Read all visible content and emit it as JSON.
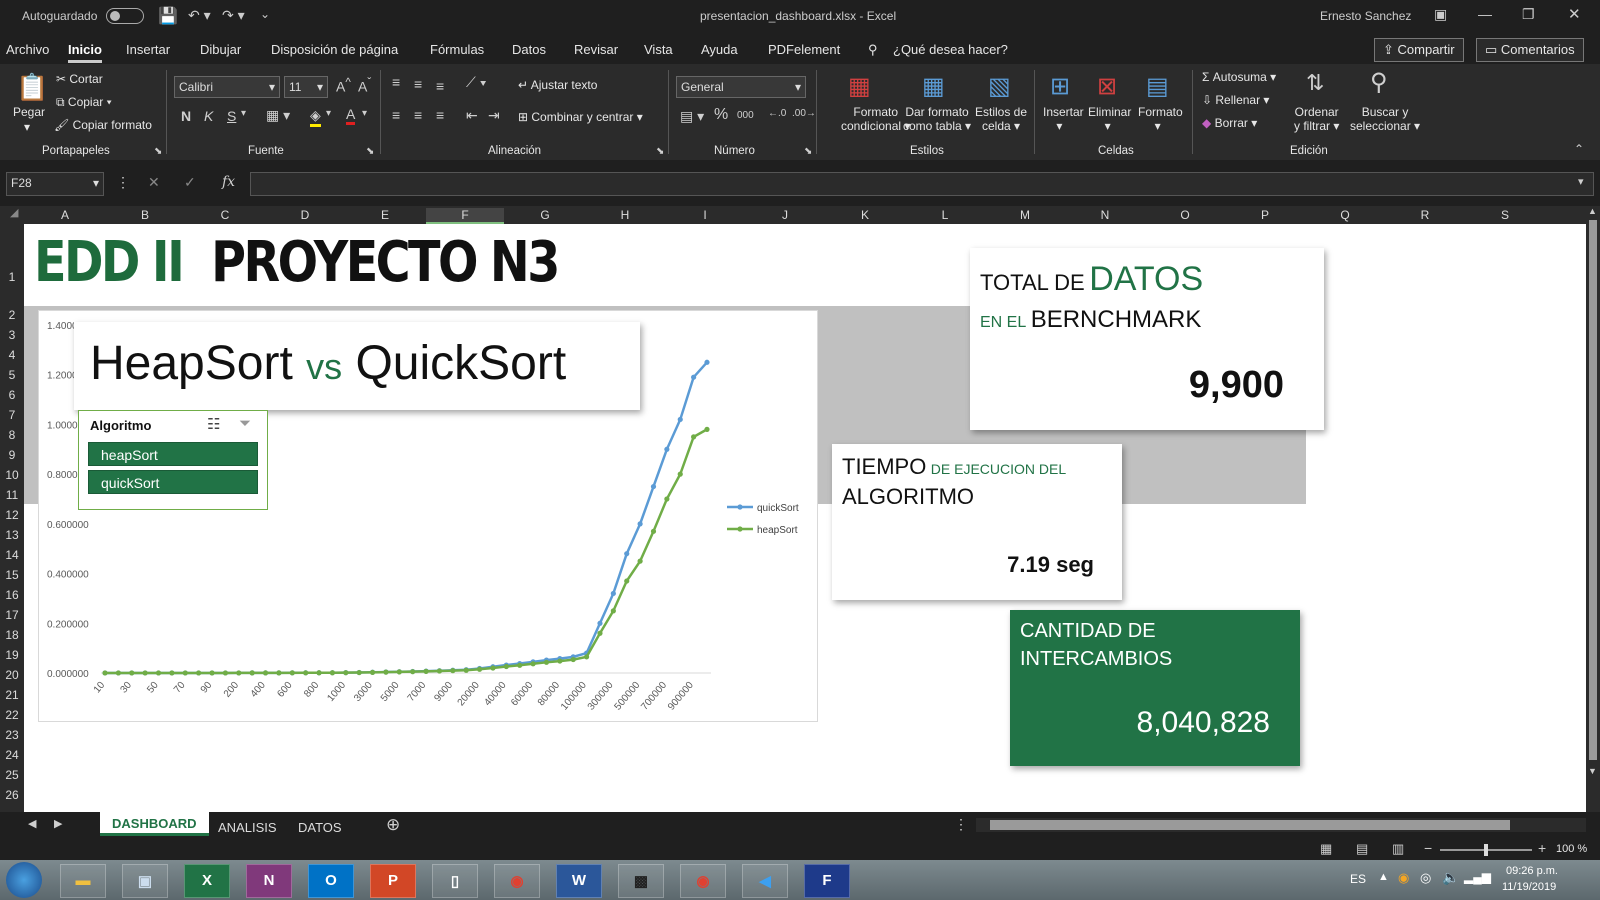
{
  "window": {
    "autosave_label": "Autoguardado",
    "title": "presentacion_dashboard.xlsx  -  Excel",
    "user": "Ernesto Sanchez"
  },
  "menu": {
    "items": [
      "Archivo",
      "Inicio",
      "Insertar",
      "Dibujar",
      "Disposición de página",
      "Fórmulas",
      "Datos",
      "Revisar",
      "Vista",
      "Ayuda",
      "PDFelement"
    ],
    "search_prompt": "¿Qué desea hacer?",
    "share": "Compartir",
    "comments": "Comentarios"
  },
  "ribbon": {
    "paste": "Pegar",
    "cut": "Cortar",
    "copy": "Copiar",
    "format_painter": "Copiar formato",
    "font_name": "Calibri",
    "font_size": "11",
    "bold": "N",
    "italic": "K",
    "underline": "S",
    "wrap_text": "Ajustar texto",
    "merge_center": "Combinar y centrar",
    "number_format": "General",
    "cond_format": [
      "Formato",
      "condicional"
    ],
    "format_table": [
      "Dar formato",
      "como tabla"
    ],
    "cell_styles": [
      "Estilos de",
      "celda"
    ],
    "insert": "Insertar",
    "delete": "Eliminar",
    "format": "Formato",
    "autosum": "Autosuma",
    "fill": "Rellenar",
    "clear": "Borrar",
    "sort_filter": [
      "Ordenar",
      "y filtrar"
    ],
    "find_select": [
      "Buscar y",
      "seleccionar"
    ],
    "groups": [
      "Portapapeles",
      "Fuente",
      "Alineación",
      "Número",
      "Estilos",
      "Celdas",
      "Edición"
    ]
  },
  "formula_bar": {
    "name_box": "F28",
    "fx": "fx"
  },
  "grid": {
    "columns": [
      "A",
      "B",
      "C",
      "D",
      "E",
      "F",
      "G",
      "H",
      "I",
      "J",
      "K",
      "L",
      "M",
      "N",
      "O",
      "P",
      "Q",
      "R",
      "S"
    ],
    "selected_column": "F",
    "rows": [
      "1",
      "2",
      "3",
      "4",
      "5",
      "6",
      "7",
      "8",
      "9",
      "10",
      "11",
      "12",
      "13",
      "14",
      "15",
      "16",
      "17",
      "18",
      "19",
      "20",
      "21",
      "22",
      "23",
      "24",
      "25",
      "26"
    ]
  },
  "dashboard": {
    "title_part1": "EDD II",
    "title_part2": "PROYECTO N3",
    "chart_title_a": "HeapSort",
    "chart_title_vs": "vs",
    "chart_title_b": "QuickSort",
    "slicer": {
      "title": "Algoritmo",
      "items": [
        "heapSort",
        "quickSort"
      ]
    },
    "total_card": {
      "l1_small": "TOTAL DE",
      "l1_big": "DATOS",
      "l2_small": "EN EL",
      "l2_big": "BERNCHMARK",
      "value": "9,900"
    },
    "time_card": {
      "l1_big": "TIEMPO",
      "l1_small": "DE EJECUCION DEL",
      "l2": "ALGORITMO",
      "value": "7.19 seg"
    },
    "swaps_card": {
      "l1": "CANTIDAD DE",
      "l2": "INTERCAMBIOS",
      "value": "8,040,828"
    }
  },
  "colors": {
    "excel_green": "#217346",
    "title_green": "#1e6b3c",
    "quick_blue": "#5b9bd5",
    "heap_green": "#70ad47"
  },
  "chart_data": {
    "type": "line",
    "title": "HeapSort vs QuickSort",
    "categories": [
      "10",
      "20",
      "30",
      "40",
      "50",
      "60",
      "70",
      "80",
      "90",
      "100",
      "200",
      "300",
      "400",
      "500",
      "600",
      "700",
      "800",
      "900",
      "1000",
      "2000",
      "3000",
      "4000",
      "5000",
      "6000",
      "7000",
      "8000",
      "9000",
      "10000",
      "20000",
      "30000",
      "40000",
      "50000",
      "60000",
      "70000",
      "80000",
      "90000",
      "100000",
      "200000",
      "300000",
      "400000",
      "500000",
      "600000",
      "700000",
      "800000",
      "900000",
      "1000000"
    ],
    "tick_labels": [
      "10",
      "30",
      "50",
      "70",
      "90",
      "200",
      "400",
      "600",
      "800",
      "1000",
      "3000",
      "5000",
      "7000",
      "9000",
      "20000",
      "40000",
      "60000",
      "80000",
      "100000",
      "300000",
      "500000",
      "700000",
      "900000"
    ],
    "y_tick_labels": [
      "0.000000",
      "0.200000",
      "0.400000",
      "0.600000",
      "0.800000",
      "1.000000",
      "1.200000",
      "1.400000"
    ],
    "ylim": [
      0,
      1.4
    ],
    "series": [
      {
        "name": "quickSort",
        "color": "#5b9bd5",
        "values": [
          0.0002,
          0.0002,
          0.0002,
          0.0002,
          0.0002,
          0.0002,
          0.0002,
          0.0002,
          0.0002,
          0.0002,
          0.0003,
          0.0004,
          0.0005,
          0.0006,
          0.0008,
          0.0009,
          0.001,
          0.0012,
          0.0015,
          0.002,
          0.003,
          0.004,
          0.005,
          0.006,
          0.0075,
          0.009,
          0.011,
          0.013,
          0.018,
          0.025,
          0.032,
          0.038,
          0.045,
          0.052,
          0.058,
          0.065,
          0.08,
          0.2,
          0.32,
          0.48,
          0.6,
          0.75,
          0.9,
          1.02,
          1.19,
          1.25
        ]
      },
      {
        "name": "heapSort",
        "color": "#70ad47",
        "values": [
          0.0002,
          0.0002,
          0.0002,
          0.0002,
          0.0002,
          0.0002,
          0.0002,
          0.0002,
          0.0002,
          0.0002,
          0.0003,
          0.0004,
          0.0005,
          0.0006,
          0.0007,
          0.0008,
          0.0009,
          0.0011,
          0.0013,
          0.0018,
          0.0026,
          0.0035,
          0.0044,
          0.0053,
          0.0065,
          0.008,
          0.0095,
          0.011,
          0.015,
          0.02,
          0.026,
          0.031,
          0.037,
          0.043,
          0.048,
          0.054,
          0.065,
          0.16,
          0.25,
          0.37,
          0.45,
          0.57,
          0.7,
          0.8,
          0.95,
          0.98
        ]
      }
    ],
    "legend_position": "right",
    "grid": false
  }
}
